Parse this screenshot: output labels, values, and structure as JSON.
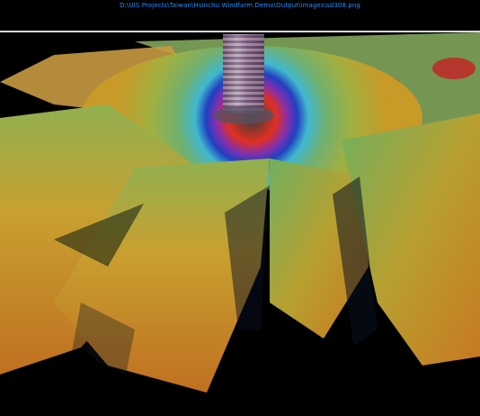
{
  "window": {
    "title_path": "D:\\UIS Projects\\Taiwan\\Hsinchu Windfarm Demo\\Output\\images\\sd308.png"
  },
  "viewport": {
    "subject": "3D multibeam bathymetry render of a wind-turbine monopile with surrounding scour pit",
    "background_color": "#000000"
  },
  "colors": {
    "title_text": "#1e90ff",
    "divider": "#d8d8d8",
    "surface_high": "#d4a020",
    "surface_mid": "#7fb050",
    "surface_low": "#3070a0",
    "scour_ring": [
      "#e03020",
      "#9030b0",
      "#2040c0",
      "#40c0d0"
    ]
  }
}
